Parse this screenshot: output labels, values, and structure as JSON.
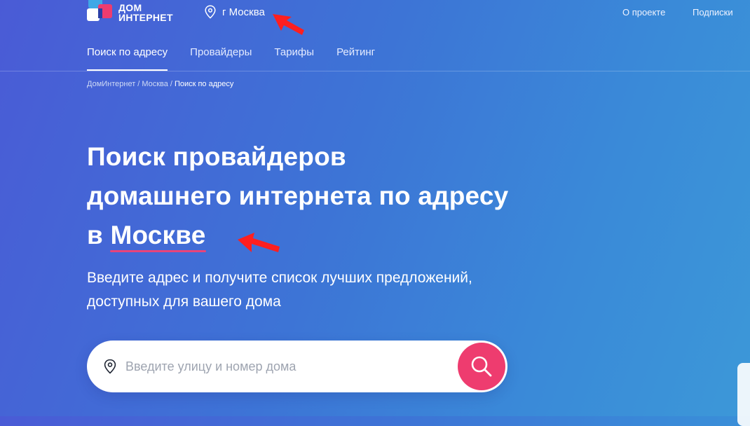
{
  "header": {
    "logo": {
      "line1": "ДОМ",
      "line2": "ИНТЕРНЕТ"
    },
    "city": "г Москва",
    "links": [
      "О проекте",
      "Подписки"
    ]
  },
  "nav": {
    "items": [
      "Поиск по адресу",
      "Провайдеры",
      "Тарифы",
      "Рейтинг"
    ],
    "active": "Поиск по адресу"
  },
  "breadcrumb": {
    "items": [
      "ДомИнтернет",
      "Москва"
    ],
    "separator": "/",
    "current": "Поиск по адресу"
  },
  "hero": {
    "title_line1": "Поиск провайдеров",
    "title_line2": "домашнего интернета по адресу",
    "title_prefix": "в",
    "title_city": "Москве",
    "subtitle_line1": "Введите адрес и получите список лучших предложений,",
    "subtitle_line2": "доступных для вашего дома"
  },
  "search": {
    "placeholder": "Введите улицу и номер дома",
    "value": "",
    "icon": "map-pin-icon",
    "button_icon": "search-icon"
  },
  "colors": {
    "accent": "#ee3c6f",
    "underline": "#e8447a",
    "annotation": "#ff1f1f"
  }
}
